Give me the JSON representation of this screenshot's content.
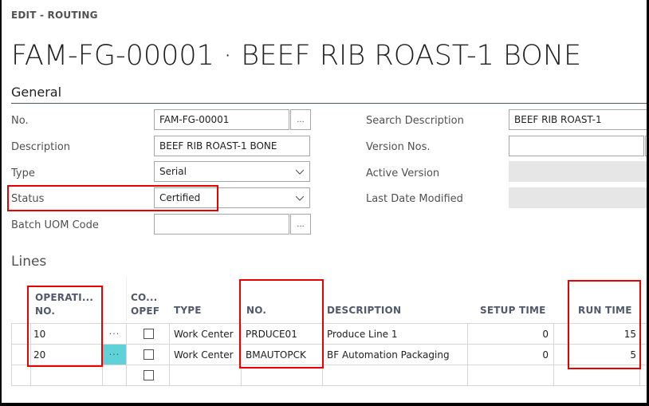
{
  "page": {
    "caption": "EDIT - ROUTING",
    "title": "FAM-FG-00001 · BEEF RIB ROAST-1 BONE"
  },
  "general": {
    "section_title": "General",
    "left_fields": [
      {
        "label": "No.",
        "value": "FAM-FG-00001",
        "control": "lookup"
      },
      {
        "label": "Description",
        "value": "BEEF RIB ROAST-1 BONE",
        "control": "text"
      },
      {
        "label": "Type",
        "value": "Serial",
        "control": "dropdown"
      },
      {
        "label": "Status",
        "value": "Certified",
        "control": "dropdown",
        "highlighted": true
      },
      {
        "label": "Batch UOM Code",
        "value": "",
        "control": "lookup"
      }
    ],
    "right_fields": [
      {
        "label": "Search Description",
        "value": "BEEF RIB ROAST-1",
        "control": "text"
      },
      {
        "label": "Version Nos.",
        "value": "",
        "control": "lookup"
      },
      {
        "label": "Active Version",
        "value": "",
        "control": "readonly"
      },
      {
        "label": "Last Date Modified",
        "value": "",
        "control": "readonly"
      }
    ]
  },
  "lines": {
    "section_title": "Lines",
    "columns": {
      "operation_no_1": "OPERATI...",
      "operation_no_2": "NO.",
      "concurrent_1": "CO...",
      "concurrent_2": "OPEF",
      "type": "TYPE",
      "no": "NO.",
      "description": "DESCRIPTION",
      "setup_time": "SETUP TIME",
      "run_time": "RUN TIME"
    },
    "row_menu_glyph": "···",
    "rows": [
      {
        "operation_no": "10",
        "concurrent": false,
        "type": "Work Center",
        "no": "PRDUCE01",
        "description": "Produce Line 1",
        "setup_time": "0",
        "run_time": "15",
        "selected": false
      },
      {
        "operation_no": "20",
        "concurrent": false,
        "type": "Work Center",
        "no": "BMAUTOPCK",
        "description": "BF Automation Packaging",
        "setup_time": "0",
        "run_time": "5",
        "selected": true
      },
      {
        "operation_no": "",
        "concurrent": false,
        "type": "",
        "no": "",
        "description": "",
        "setup_time": "",
        "run_time": "",
        "selected": false
      }
    ]
  },
  "colors": {
    "highlight_box": "#e60000",
    "selected_row_menu": "#5ed1d9",
    "readonly_field": "#e6e6e6"
  }
}
